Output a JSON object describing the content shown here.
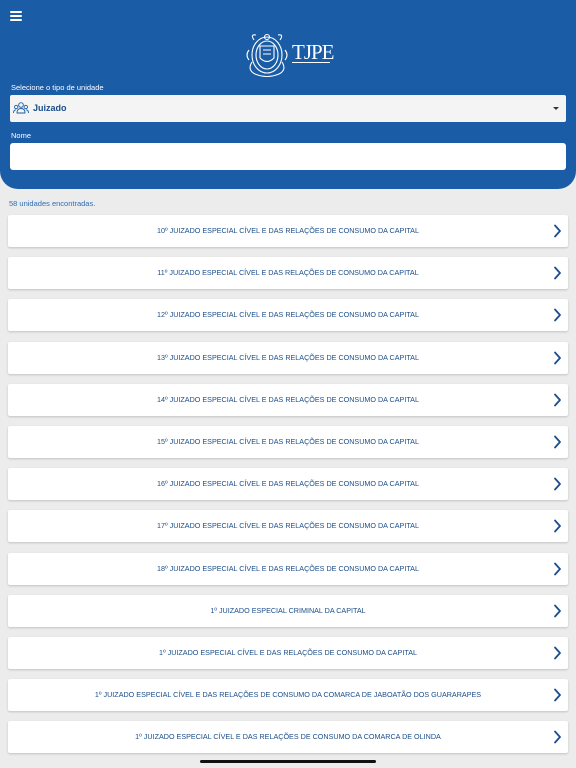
{
  "header": {
    "logo_text": "TJPE",
    "unit_type_label": "Selecione o tipo de unidade",
    "unit_type_value": "Juizado",
    "name_label": "Nome",
    "name_value": ""
  },
  "results": {
    "count_text": "58 unidades encontradas.",
    "items": [
      "10º JUIZADO ESPECIAL CÍVEL E DAS RELAÇÕES DE CONSUMO DA CAPITAL",
      "11º JUIZADO ESPECIAL CÍVEL E DAS RELAÇÕES DE CONSUMO DA CAPITAL",
      "12º JUIZADO ESPECIAL CÍVEL E DAS RELAÇÕES DE CONSUMO DA CAPITAL",
      "13º JUIZADO ESPECIAL CÍVEL E DAS RELAÇÕES DE CONSUMO DA CAPITAL",
      "14º JUIZADO ESPECIAL CÍVEL E DAS RELAÇÕES DE CONSUMO DA CAPITAL",
      "15º JUIZADO ESPECIAL CÍVEL E DAS RELAÇÕES DE CONSUMO DA CAPITAL",
      "16º JUIZADO ESPECIAL CÍVEL E DAS RELAÇÕES DE CONSUMO DA CAPITAL",
      "17º JUIZADO ESPECIAL CÍVEL E DAS RELAÇÕES DE CONSUMO DA CAPITAL",
      "18º JUIZADO ESPECIAL CÍVEL E DAS RELAÇÕES DE CONSUMO DA CAPITAL",
      "1º JUIZADO ESPECIAL CRIMINAL DA CAPITAL",
      "1º JUIZADO ESPECIAL CÍVEL E DAS RELAÇÕES DE CONSUMO DA CAPITAL",
      "1º JUIZADO ESPECIAL CÍVEL E DAS RELAÇÕES DE CONSUMO DA COMARCA DE JABOATÃO DOS GUARARAPES",
      "1º JUIZADO ESPECIAL CÍVEL E DAS RELAÇÕES DE CONSUMO DA COMARCA DE OLINDA"
    ]
  },
  "icons": {
    "menu": "menu-icon",
    "logo": "tjpe-coat-of-arms",
    "unit_type": "people-group-icon",
    "dropdown": "caret-down-icon",
    "item_arrow": "chevron-right-icon"
  },
  "colors": {
    "header_bg": "#1a5ca6",
    "page_bg": "#ececec",
    "item_text": "#1a4d8a",
    "count_text": "#2d6db3"
  }
}
